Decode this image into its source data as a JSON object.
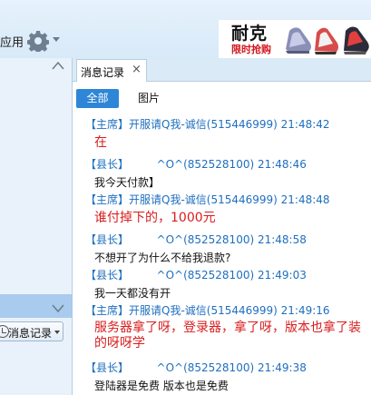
{
  "topbar": {
    "app_label": "应用",
    "ad": {
      "brand": "耐克",
      "slogan": "限时抢购"
    }
  },
  "left": {
    "msg_record_label": "消息记录"
  },
  "tabs": [
    {
      "label": "消息记录",
      "close": "×"
    }
  ],
  "filters": {
    "all": "全部",
    "pictures": "图片"
  },
  "messages": [
    {
      "header": "【主席】开服请Q我-诚信(515446999) 21:48:42",
      "body": "在",
      "emph": true
    },
    {
      "header": "【县长】        ^O^(852528100) 21:48:46",
      "body": "我今天付款】",
      "emph": false
    },
    {
      "header": "【主席】开服请Q我-诚信(515446999) 21:48:48",
      "body": "谁付掉下的，1000元",
      "emph": true
    },
    {
      "header": "【县长】        ^O^(852528100) 21:48:58",
      "body": "不想开了为什么不给我退款?",
      "emph": false
    },
    {
      "header": "【县长】        ^O^(852528100) 21:49:03",
      "body": "我一天都没有开",
      "emph": false
    },
    {
      "header": "【主席】开服请Q我-诚信(515446999) 21:49:16",
      "body": "服务器拿了呀，登录器，拿了呀，版本也拿了装的呀呀学",
      "emph": true
    },
    {
      "header": "【县长】        ^O^(852528100) 21:49:38",
      "body": "登陆器是免费 版本也是免费",
      "emph": false
    }
  ],
  "colors": {
    "accent": "#2e86d6",
    "header_text": "#1e6fbf",
    "emphasis_text": "#d81e1e"
  }
}
